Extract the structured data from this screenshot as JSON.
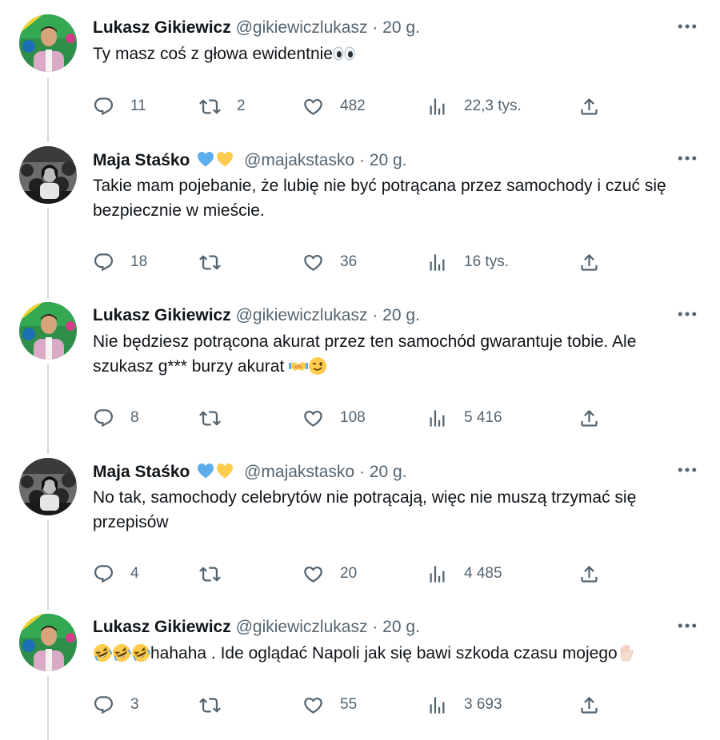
{
  "tweets": [
    {
      "author": "Lukasz Gikiewicz",
      "handle": "@gikiewiczlukasz",
      "dot": "·",
      "time": "20 g.",
      "text": "Ty masz coś z głowa ewidentnie",
      "text_emoji": [
        "eyes-emoji"
      ],
      "replies": "11",
      "retweets": "2",
      "likes": "482",
      "views": "22,3 tys."
    },
    {
      "author": "Maja Staśko",
      "handle": "@majakstasko",
      "dot": "·",
      "time": "20 g.",
      "name_emoji": [
        "blue-heart-emoji",
        "yellow-heart-emoji"
      ],
      "text": "Takie mam pojebanie, że lubię nie być potrącana przez samochody i czuć się bezpiecznie w mieście.",
      "replies": "18",
      "retweets": "",
      "likes": "36",
      "views": "16 tys."
    },
    {
      "author": "Lukasz Gikiewicz",
      "handle": "@gikiewiczlukasz",
      "dot": "·",
      "time": "20 g.",
      "text": "Nie będziesz potrącona akurat przez ten samochód gwarantuje tobie. Ale szukasz g*** burzy akurat",
      "text_emoji": [
        "handshake-emoji",
        "winking-face-emoji"
      ],
      "replies": "8",
      "retweets": "",
      "likes": "108",
      "views": "5 416"
    },
    {
      "author": "Maja Staśko",
      "handle": "@majakstasko",
      "dot": "·",
      "time": "20 g.",
      "name_emoji": [
        "blue-heart-emoji",
        "yellow-heart-emoji"
      ],
      "text": "No tak, samochody celebrytów nie potrącają, więc nie muszą trzymać się przepisów",
      "replies": "4",
      "retweets": "",
      "likes": "20",
      "views": "4 485"
    },
    {
      "author": "Lukasz Gikiewicz",
      "handle": "@gikiewiczlukasz",
      "dot": "·",
      "time": "20 g.",
      "text_prefix_emoji": [
        "rolling-laughing-emoji",
        "rolling-laughing-emoji",
        "rolling-laughing-emoji"
      ],
      "text": "hahaha . Ide oglądać Napoli jak się bawi szkoda czasu mojego",
      "text_emoji": [
        "raised-hand-emoji"
      ],
      "replies": "3",
      "retweets": "",
      "likes": "55",
      "views": "3 693"
    }
  ],
  "colors": {
    "text": "#0f1419",
    "secondary": "#536471",
    "thread_line": "#cfd9de",
    "background": "#ffffff"
  },
  "icons": [
    "more-icon",
    "reply-icon",
    "retweet-icon",
    "like-icon",
    "views-icon",
    "share-icon"
  ]
}
